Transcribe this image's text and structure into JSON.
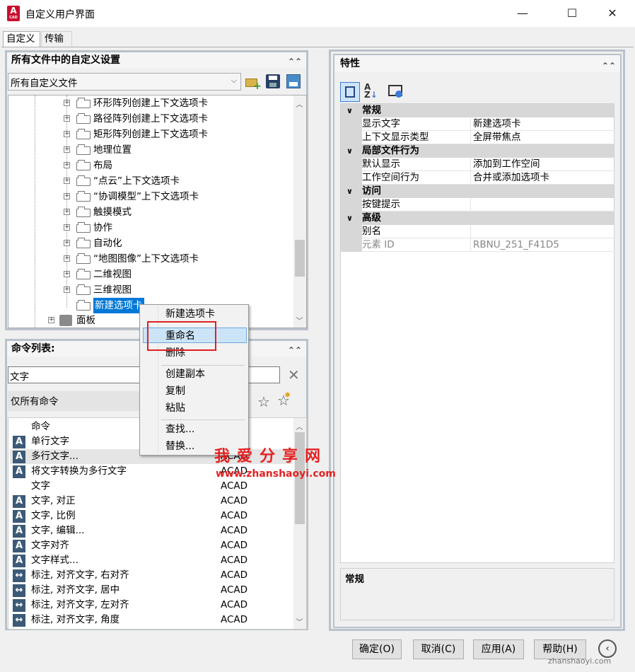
{
  "window": {
    "title": "自定义用户界面",
    "minimize": "—",
    "maximize": "☐",
    "close": "✕"
  },
  "app_icon": {
    "letter": "A",
    "sub": "CAD"
  },
  "tabs": [
    "自定义",
    "传输"
  ],
  "left_top": {
    "title": "所有文件中的自定义设置",
    "combo_value": "所有自定义文件",
    "tree": [
      "环形阵列创建上下文选项卡",
      "路径阵列创建上下文选项卡",
      "矩形阵列创建上下文选项卡",
      "地理位置",
      "布局",
      "“点云”上下文选项卡",
      "“协调模型”上下文选项卡",
      "触摸模式",
      "协作",
      "自动化",
      "“地图图像”上下文选项卡",
      "二维视图",
      "三维视图",
      "新建选项卡"
    ],
    "panel_node": "面板"
  },
  "context_menu": {
    "items": [
      "新建选项卡",
      "重命名",
      "删除",
      "创建副本",
      "复制",
      "粘贴",
      "查找...",
      "替换..."
    ]
  },
  "command_list": {
    "title": "命令列表:",
    "search_value": "文字",
    "filter_value": "仅所有命令",
    "col_command": "命令",
    "rows": [
      {
        "name": "单行文字",
        "src": ""
      },
      {
        "name": "多行文字...",
        "src": "ACAD"
      },
      {
        "name": "将文字转换为多行文字",
        "src": "ACAD"
      },
      {
        "name": "文字",
        "src": "ACAD"
      },
      {
        "name": "文字, 对正",
        "src": "ACAD"
      },
      {
        "name": "文字, 比例",
        "src": "ACAD"
      },
      {
        "name": "文字, 编辑...",
        "src": "ACAD"
      },
      {
        "name": "文字对齐",
        "src": "ACAD"
      },
      {
        "name": "文字样式...",
        "src": "ACAD"
      },
      {
        "name": "标注, 对齐文字, 右对齐",
        "src": "ACAD"
      },
      {
        "name": "标注, 对齐文字, 居中",
        "src": "ACAD"
      },
      {
        "name": "标注, 对齐文字, 左对齐",
        "src": "ACAD"
      },
      {
        "name": "标注, 对齐文字, 角度",
        "src": "ACAD"
      }
    ]
  },
  "properties": {
    "title": "特性",
    "categories": [
      {
        "name": "常规",
        "rows": [
          {
            "k": "显示文字",
            "v": "新建选项卡"
          },
          {
            "k": "上下文显示类型",
            "v": "全屏带焦点"
          }
        ]
      },
      {
        "name": "局部文件行为",
        "rows": [
          {
            "k": "默认显示",
            "v": "添加到工作空间"
          },
          {
            "k": "工作空间行为",
            "v": "合并或添加选项卡"
          }
        ]
      },
      {
        "name": "访问",
        "rows": [
          {
            "k": "按键提示",
            "v": ""
          }
        ]
      },
      {
        "name": "高级",
        "rows": [
          {
            "k": "别名",
            "v": ""
          },
          {
            "k": "元素 ID",
            "v": "RBNU_251_F41D5"
          }
        ]
      }
    ],
    "description_title": "常规"
  },
  "buttons": {
    "ok": "确定(O)",
    "cancel": "取消(C)",
    "apply": "应用(A)",
    "help": "帮助(H)"
  },
  "watermark": {
    "cn": "我爱分享网",
    "url": "www.zhanshaoyi.com",
    "corner": "zhanshaoyi.com"
  }
}
